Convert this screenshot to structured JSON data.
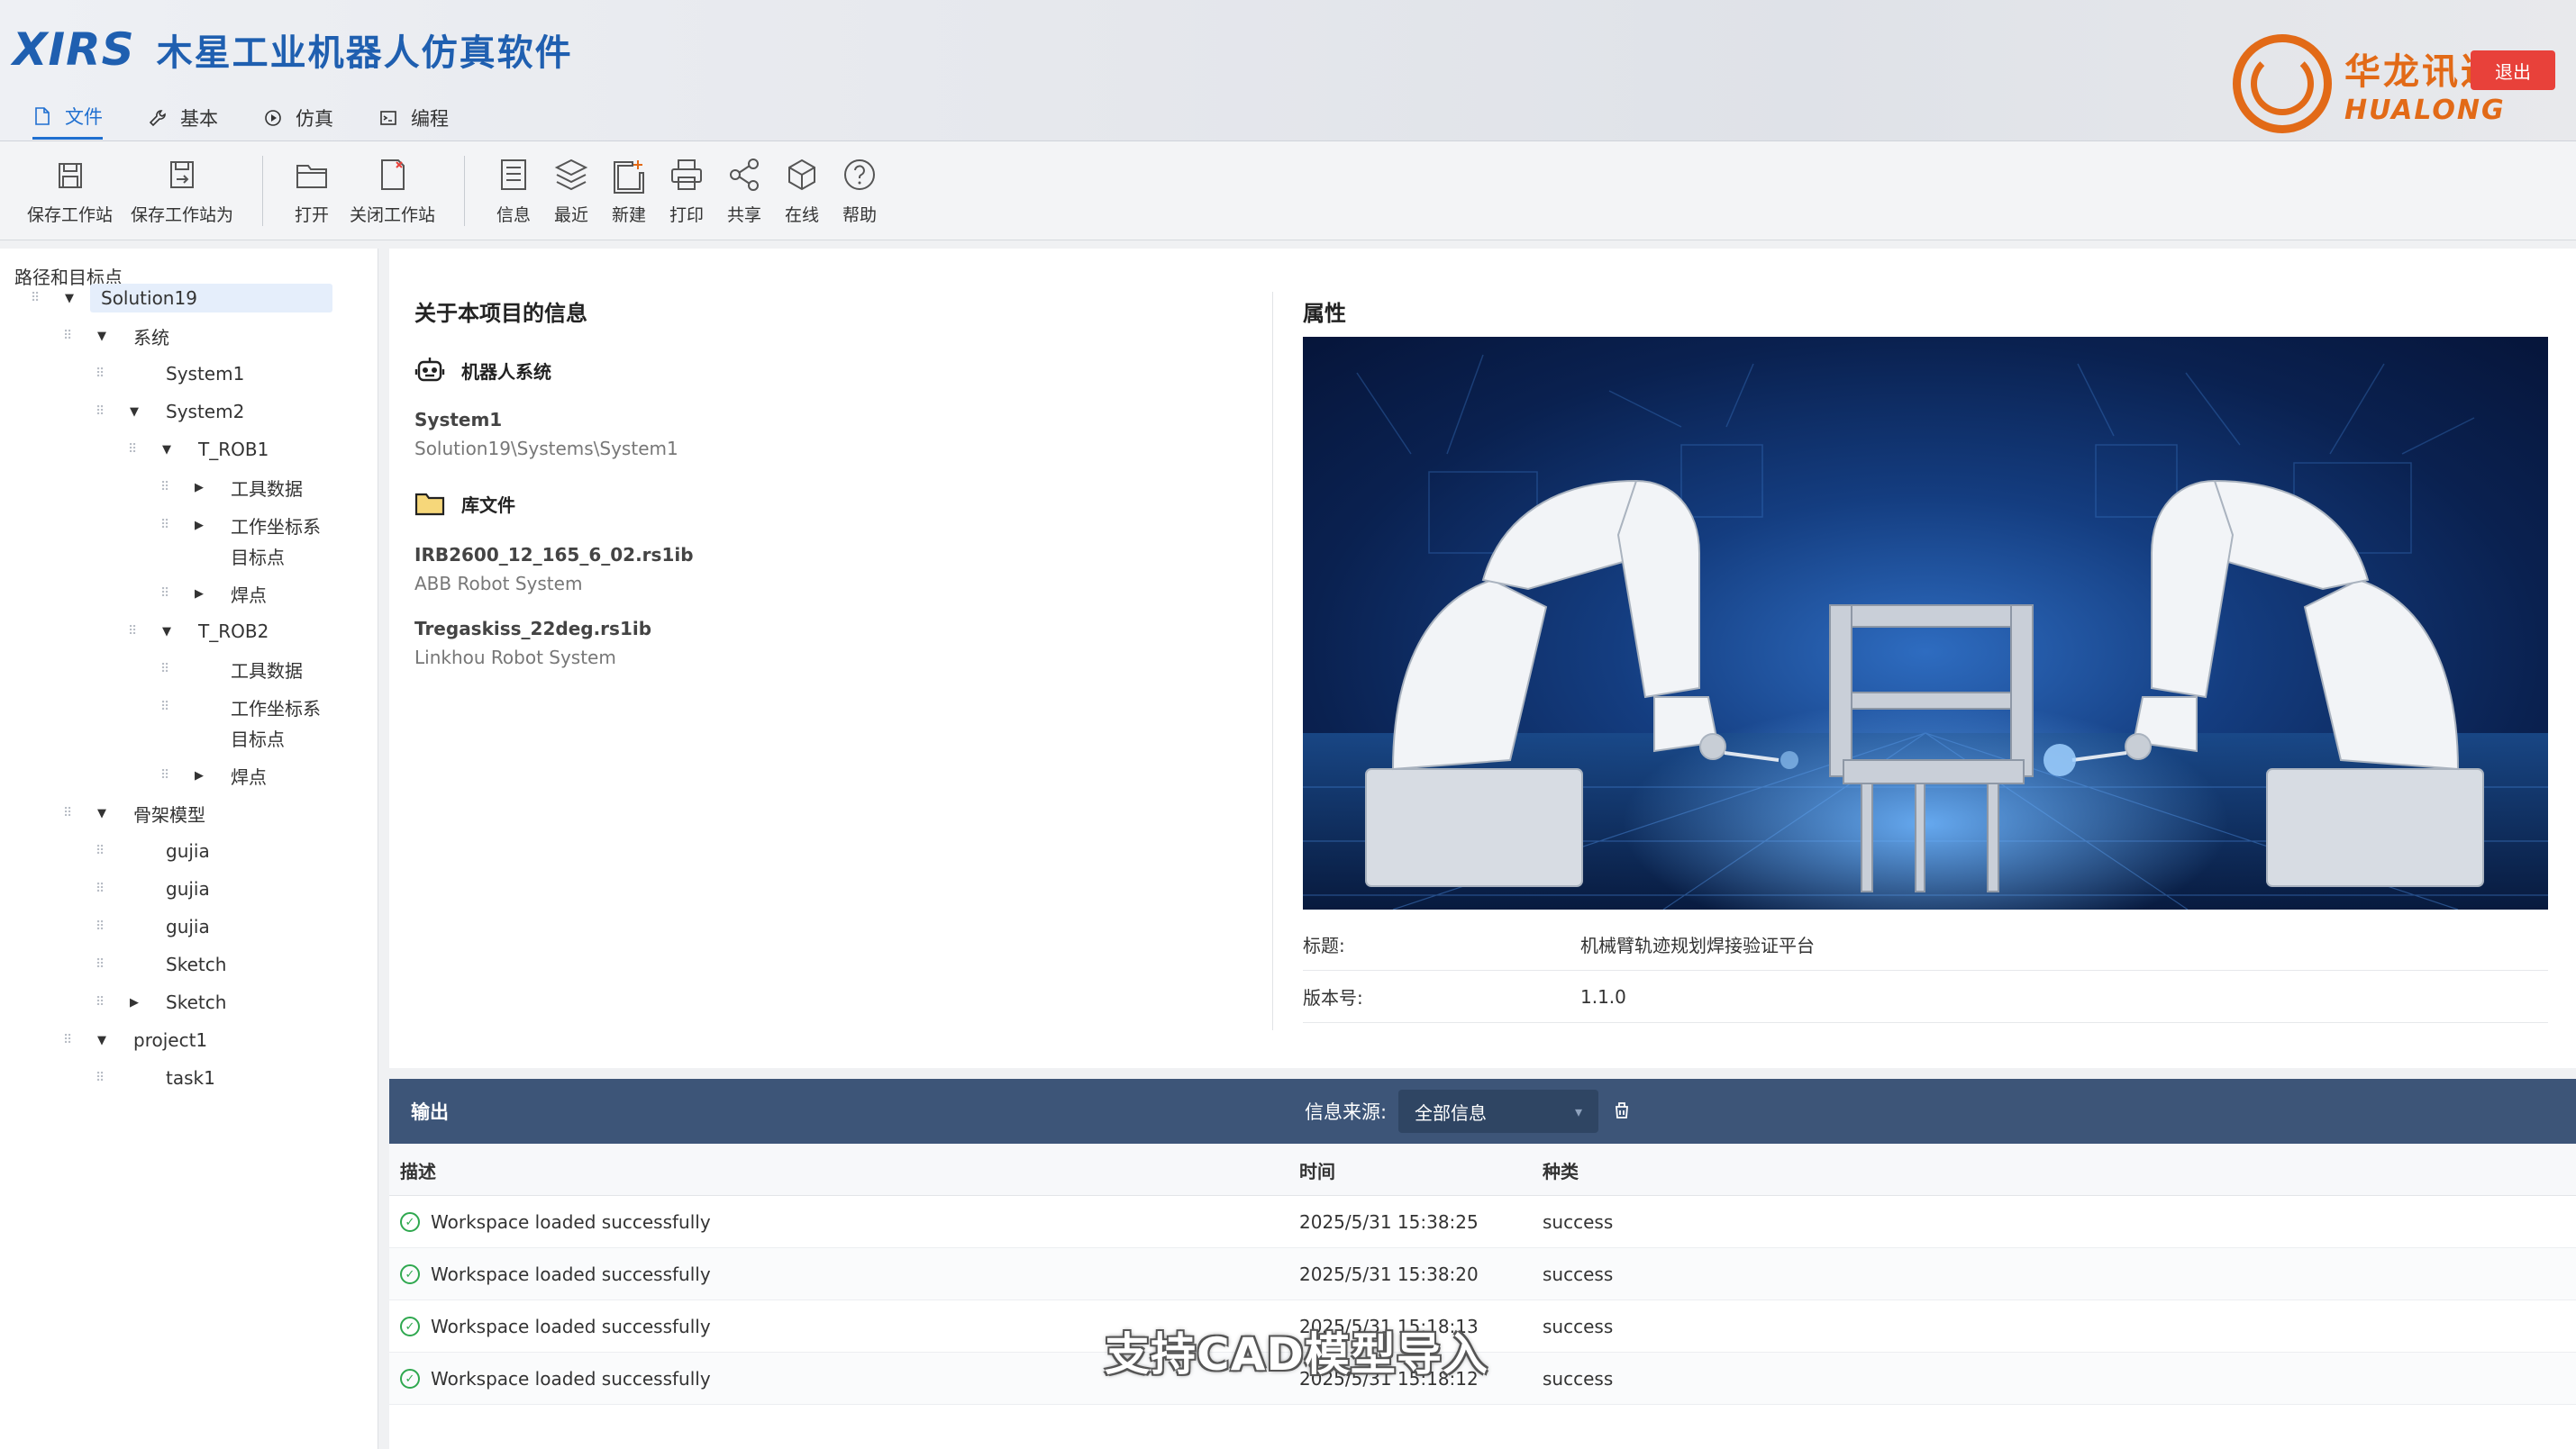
{
  "header": {
    "logo": "XIRS",
    "title": "木星工业机器人仿真软件",
    "brand_cn": "华龙讯达",
    "brand_en": "HUALONG",
    "exit_label": "退出"
  },
  "menu": {
    "tabs": [
      {
        "label": "文件",
        "icon": "file-icon",
        "active": true
      },
      {
        "label": "基本",
        "icon": "wrench-icon",
        "active": false
      },
      {
        "label": "仿真",
        "icon": "play-circle-icon",
        "active": false
      },
      {
        "label": "编程",
        "icon": "terminal-icon",
        "active": false
      }
    ]
  },
  "toolbar": {
    "save_station": "保存工作站",
    "save_station_as": "保存工作站为",
    "open": "打开",
    "close_station": "关闭工作站",
    "info": "信息",
    "recent": "最近",
    "new": "新建",
    "print": "打印",
    "share": "共享",
    "online": "在线",
    "help": "帮助"
  },
  "tree": {
    "title": "路径和目标点",
    "nodes": [
      {
        "label": "Solution19",
        "caret": "down",
        "selected": true
      },
      {
        "label": "系统",
        "caret": "down"
      },
      {
        "label": "System1",
        "caret": ""
      },
      {
        "label": "System2",
        "caret": "down"
      },
      {
        "label": "T_ROB1",
        "caret": "down"
      },
      {
        "label": "工具数据",
        "caret": "right"
      },
      {
        "label": "工作坐标系",
        "caret": "right"
      },
      {
        "label": "目标点",
        "caret": ""
      },
      {
        "label": "焊点",
        "caret": "right"
      },
      {
        "label": "T_ROB2",
        "caret": "down"
      },
      {
        "label": "工具数据",
        "caret": ""
      },
      {
        "label": "工作坐标系",
        "caret": ""
      },
      {
        "label": "目标点",
        "caret": ""
      },
      {
        "label": "焊点",
        "caret": "right"
      },
      {
        "label": "骨架模型",
        "caret": "down"
      },
      {
        "label": "gujia",
        "caret": ""
      },
      {
        "label": "gujia",
        "caret": ""
      },
      {
        "label": "gujia",
        "caret": ""
      },
      {
        "label": "Sketch",
        "caret": ""
      },
      {
        "label": "Sketch",
        "caret": "right"
      },
      {
        "label": "project1",
        "caret": "down"
      },
      {
        "label": "task1",
        "caret": ""
      }
    ]
  },
  "info": {
    "title": "关于本项目的信息",
    "robot_system_heading": "机器人系统",
    "system_name": "System1",
    "system_path": "Solution19\\Systems\\System1",
    "library_heading": "库文件",
    "libraries": [
      {
        "name": "IRB2600_12_165_6_02.rs1ib",
        "desc": "ABB Robot System"
      },
      {
        "name": "Tregaskiss_22deg.rs1ib",
        "desc": "Linkhou Robot System"
      }
    ]
  },
  "properties": {
    "title": "属性",
    "rows": [
      {
        "key": "标题:",
        "value": "机械臂轨迹规划焊接验证平台"
      },
      {
        "key": "版本号:",
        "value": "1.1.0"
      }
    ]
  },
  "output": {
    "title": "输出",
    "source_label": "信息来源:",
    "source_value": "全部信息",
    "columns": {
      "desc": "描述",
      "time": "时间",
      "type": "种类"
    },
    "rows": [
      {
        "desc": "Workspace loaded successfully",
        "time": "2025/5/31 15:38:25",
        "type": "success"
      },
      {
        "desc": "Workspace loaded successfully",
        "time": "2025/5/31 15:38:20",
        "type": "success"
      },
      {
        "desc": "Workspace loaded successfully",
        "time": "2025/5/31 15:18:13",
        "type": "success"
      },
      {
        "desc": "Workspace loaded successfully",
        "time": "2025/5/31 15:18:12",
        "type": "success"
      }
    ]
  },
  "caption": "支持CAD模型导入",
  "colors": {
    "accent": "#1f5fb0",
    "brand": "#e26a17",
    "output_header": "#3d5578",
    "success": "#2fa84f",
    "exit": "#e8413a"
  }
}
